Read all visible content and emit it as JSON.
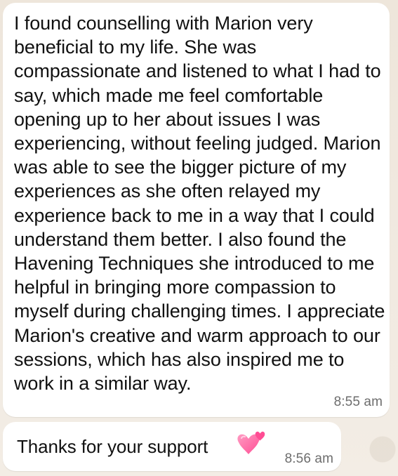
{
  "messages": [
    {
      "text": "I found counselling with Marion very beneficial to my life. She was compassionate and listened to what I had to say, which made me feel comfortable opening up to her about issues I was experiencing, without feeling judged. Marion was able to see the bigger picture of my experiences as she often relayed my experience back to me in a way that I could understand them better. I also found the Havening Techniques she introduced to me helpful in bringing more compassion to myself during challenging times. I appreciate Marion's creative and warm approach to our sessions, which has also inspired me to work in a similar way.",
      "time": "8:55 am"
    },
    {
      "text": "Thanks for your support",
      "emoji": "two-hearts-icon",
      "time": "8:56 am"
    }
  ],
  "colors": {
    "background": "#efe7dc",
    "bubble": "#ffffff",
    "text": "#111111",
    "timestamp": "#6d6d6d",
    "heart_main": "#ff6fa6",
    "heart_small": "#ff4d94"
  }
}
